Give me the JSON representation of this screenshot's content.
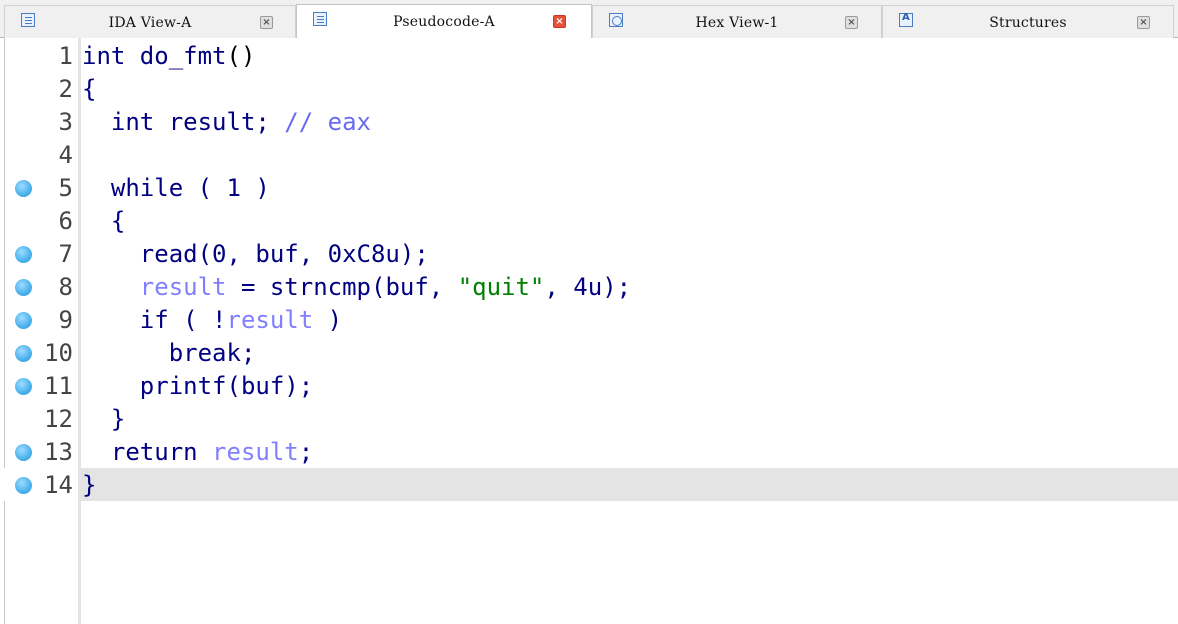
{
  "tabs": [
    {
      "label": "IDA View-A",
      "icon": "disassembly-view-icon",
      "active": false,
      "close": "×"
    },
    {
      "label": "Pseudocode-A",
      "icon": "pseudocode-view-icon",
      "active": true,
      "close": "×"
    },
    {
      "label": "Hex View-1",
      "icon": "hex-view-icon",
      "active": false,
      "close": "×"
    },
    {
      "label": "Structures",
      "icon": "structures-view-icon",
      "active": false,
      "close": "×"
    }
  ],
  "colors": {
    "keyword": "#000080",
    "comment_var": "#8080ff",
    "string": "#008000",
    "breakpoint": "#4fb4ee",
    "current_line": "#e4e4e4",
    "active_close": "#e8503a"
  },
  "code_lines": [
    {
      "num": "1",
      "breakpoint": false,
      "parts": [
        {
          "t": "int do_fmt",
          "c": "kw"
        },
        {
          "t": "()",
          "c": "blk"
        }
      ]
    },
    {
      "num": "2",
      "breakpoint": false,
      "parts": [
        {
          "t": "{",
          "c": "kw"
        }
      ]
    },
    {
      "num": "3",
      "breakpoint": false,
      "parts": [
        {
          "t": "  int result; ",
          "c": "kw"
        },
        {
          "t": "// eax",
          "c": "cmt"
        }
      ]
    },
    {
      "num": "4",
      "breakpoint": false,
      "parts": []
    },
    {
      "num": "5",
      "breakpoint": true,
      "parts": [
        {
          "t": "  while ( 1 )",
          "c": "kw"
        }
      ]
    },
    {
      "num": "6",
      "breakpoint": false,
      "parts": [
        {
          "t": "  {",
          "c": "kw"
        }
      ]
    },
    {
      "num": "7",
      "breakpoint": true,
      "parts": [
        {
          "t": "    read(0, buf, 0xC8u);",
          "c": "kw"
        }
      ]
    },
    {
      "num": "8",
      "breakpoint": true,
      "parts": [
        {
          "t": "    ",
          "c": "kw"
        },
        {
          "t": "result",
          "c": "var"
        },
        {
          "t": " = strncmp(buf, ",
          "c": "kw"
        },
        {
          "t": "\"quit\"",
          "c": "str"
        },
        {
          "t": ", 4u);",
          "c": "kw"
        }
      ]
    },
    {
      "num": "9",
      "breakpoint": true,
      "parts": [
        {
          "t": "    if ( !",
          "c": "kw"
        },
        {
          "t": "result",
          "c": "var"
        },
        {
          "t": " )",
          "c": "kw"
        }
      ]
    },
    {
      "num": "10",
      "breakpoint": true,
      "parts": [
        {
          "t": "      break;",
          "c": "kw"
        }
      ]
    },
    {
      "num": "11",
      "breakpoint": true,
      "parts": [
        {
          "t": "    printf(buf);",
          "c": "kw"
        }
      ]
    },
    {
      "num": "12",
      "breakpoint": false,
      "parts": [
        {
          "t": "  }",
          "c": "kw"
        }
      ]
    },
    {
      "num": "13",
      "breakpoint": true,
      "parts": [
        {
          "t": "  return ",
          "c": "kw"
        },
        {
          "t": "result",
          "c": "var"
        },
        {
          "t": ";",
          "c": "kw"
        }
      ]
    },
    {
      "num": "14",
      "breakpoint": true,
      "current": true,
      "parts": [
        {
          "t": "}",
          "c": "kw"
        }
      ]
    }
  ]
}
